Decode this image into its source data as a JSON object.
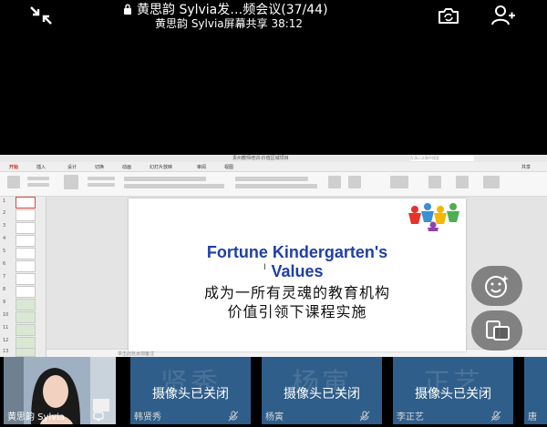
{
  "meeting": {
    "title": "黄思韵 Sylvia发…频会议(37/44)",
    "share_status": "黄思韵 Sylvia屏幕共享  38:12"
  },
  "ppt": {
    "window_title": "贵州教师培训-价值区域项目",
    "search_placeholder": "在演示文稿中搜索",
    "tabs": [
      "开始",
      "插入",
      "设计",
      "切换",
      "动画",
      "幻灯片放映",
      "审阅",
      "视图"
    ],
    "share_label": "共享",
    "thumb_numbers": [
      "1",
      "2",
      "3",
      "4",
      "5",
      "6",
      "7",
      "8",
      "9",
      "10",
      "11",
      "12",
      "13"
    ],
    "notes_text": "单击此处添加备注"
  },
  "slide": {
    "title_line1": "Fortune Kindergarten's",
    "title_line2": "Values",
    "zh_line1": "成为一所有灵魂的教育机构",
    "zh_line2": "价值引领下课程实施"
  },
  "participants": [
    {
      "name": "黄思韵 Sylvia",
      "video": true
    },
    {
      "name": "韩贤秀",
      "ghost": "贤秀",
      "status": "摄像头已关闭"
    },
    {
      "name": "杨寅",
      "ghost": "杨寅",
      "status": "摄像头已关闭"
    },
    {
      "name": "李正艺",
      "ghost": "正艺",
      "status": "摄像头已关闭"
    },
    {
      "name": "唐",
      "ghost": "",
      "status": ""
    }
  ],
  "colors": {
    "tile_bg": "#2f5e8a",
    "slide_title": "#1f3fa6",
    "ppt_accent": "#c23b22"
  }
}
